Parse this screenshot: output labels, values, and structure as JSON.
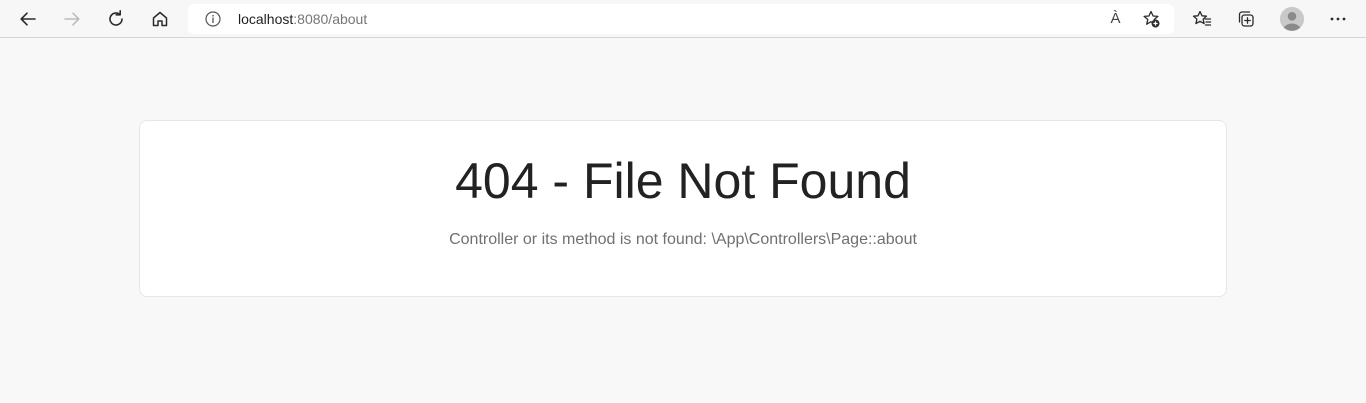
{
  "browser": {
    "url_host": "localhost",
    "url_rest": ":8080/about",
    "read_aloud_label": "À",
    "icons": {
      "back": "back-arrow-icon",
      "forward": "forward-arrow-icon",
      "refresh": "refresh-icon",
      "home": "home-icon",
      "site_info": "info-icon",
      "read_aloud": "read-aloud-icon",
      "add_favorite": "add-favorite-icon",
      "favorites": "favorites-icon",
      "collections": "collections-icon",
      "profile": "profile-avatar-icon",
      "menu": "more-menu-icon"
    }
  },
  "page": {
    "title": "404 - File Not Found",
    "message": "Controller or its method is not found: \\App\\Controllers\\Page::about"
  },
  "colors": {
    "page_background": "#f8f8f8",
    "card_background": "#ffffff",
    "title_text": "#222222",
    "message_text": "#707070"
  }
}
